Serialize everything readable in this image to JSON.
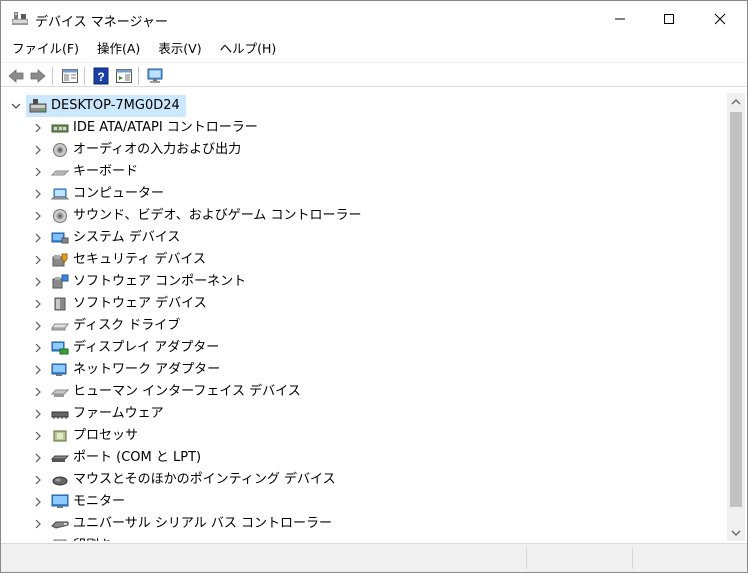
{
  "window": {
    "title": "デバイス マネージャー",
    "minimize": "—",
    "maximize": "☐",
    "close": "✕"
  },
  "menu": [
    {
      "label": "ファイル(F)"
    },
    {
      "label": "操作(A)"
    },
    {
      "label": "表示(V)"
    },
    {
      "label": "ヘルプ(H)"
    }
  ],
  "tree": {
    "root": {
      "label": "DESKTOP-7MG0D24",
      "expanded": true
    },
    "items": [
      {
        "label": "IDE ATA/ATAPI コントローラー",
        "icon": "ide-controller-icon"
      },
      {
        "label": "オーディオの入力および出力",
        "icon": "speaker-icon"
      },
      {
        "label": "キーボード",
        "icon": "keyboard-icon"
      },
      {
        "label": "コンピューター",
        "icon": "computer-icon"
      },
      {
        "label": "サウンド、ビデオ、およびゲーム コントローラー",
        "icon": "sound-icon"
      },
      {
        "label": "システム デバイス",
        "icon": "system-device-icon"
      },
      {
        "label": "セキュリティ デバイス",
        "icon": "security-device-icon"
      },
      {
        "label": "ソフトウェア コンポーネント",
        "icon": "software-component-icon"
      },
      {
        "label": "ソフトウェア デバイス",
        "icon": "software-device-icon"
      },
      {
        "label": "ディスク ドライブ",
        "icon": "disk-drive-icon"
      },
      {
        "label": "ディスプレイ アダプター",
        "icon": "display-adapter-icon"
      },
      {
        "label": "ネットワーク アダプター",
        "icon": "network-adapter-icon"
      },
      {
        "label": "ヒューマン インターフェイス デバイス",
        "icon": "hid-icon"
      },
      {
        "label": "ファームウェア",
        "icon": "firmware-icon"
      },
      {
        "label": "プロセッサ",
        "icon": "processor-icon"
      },
      {
        "label": "ポート (COM と LPT)",
        "icon": "port-icon"
      },
      {
        "label": "マウスとそのほかのポインティング デバイス",
        "icon": "mouse-icon"
      },
      {
        "label": "モニター",
        "icon": "monitor-icon"
      },
      {
        "label": "ユニバーサル シリアル バス コントローラー",
        "icon": "usb-controller-icon"
      },
      {
        "label": "印刷キュー",
        "icon": "printer-icon"
      }
    ]
  },
  "colors": {
    "selection": "#cce8ff",
    "scroll_thumb": "#c2c2c2",
    "statusbar": "#f0f0f0"
  }
}
